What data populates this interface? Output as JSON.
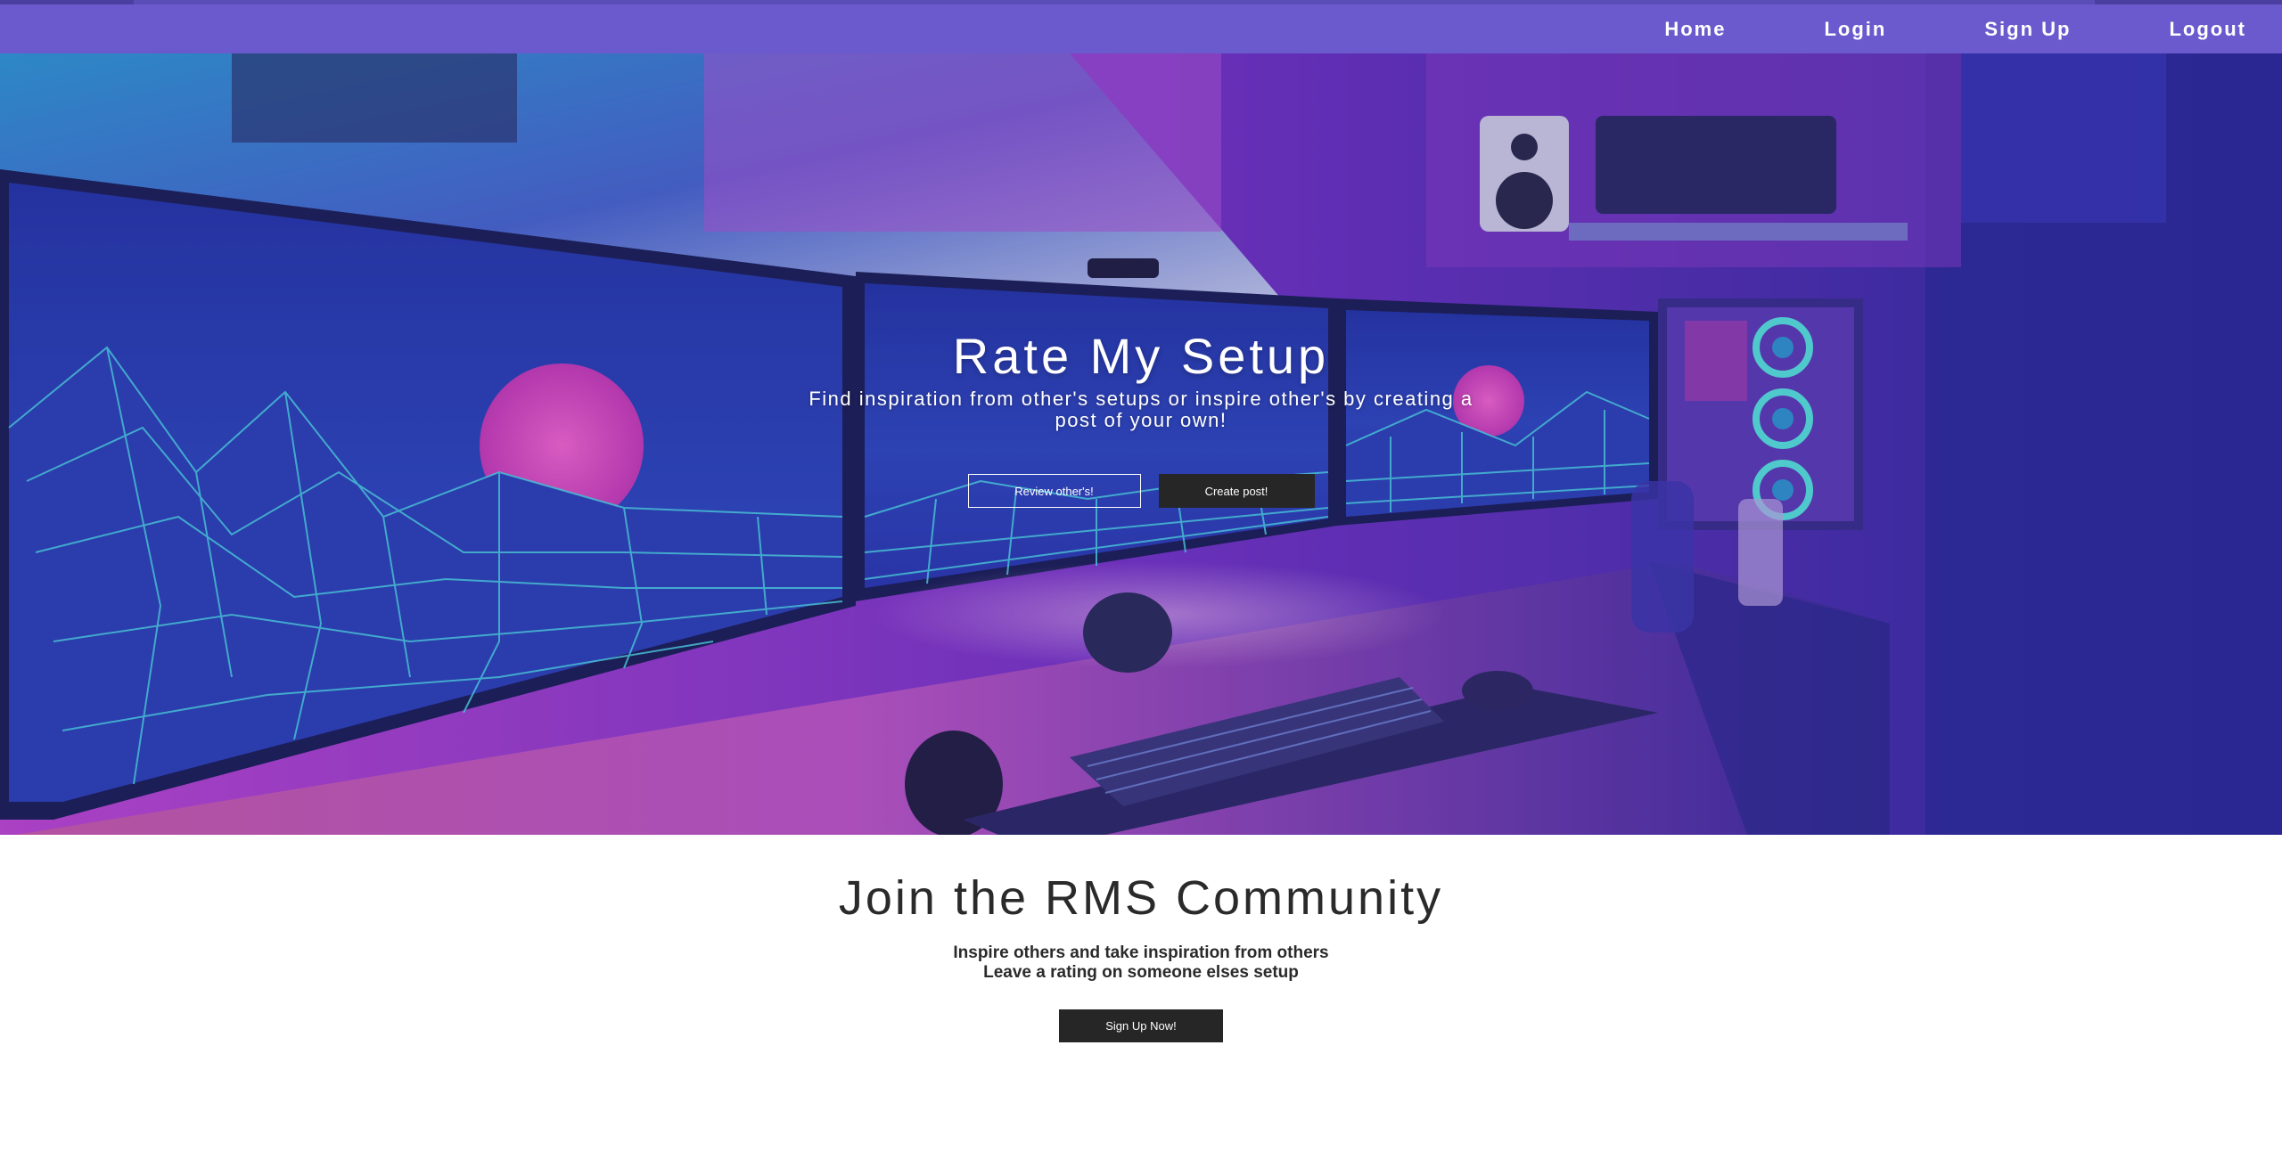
{
  "nav": {
    "items": [
      {
        "label": "Home"
      },
      {
        "label": "Login"
      },
      {
        "label": "Sign Up"
      },
      {
        "label": "Logout"
      }
    ]
  },
  "hero": {
    "title": "Rate My Setup",
    "subtitle": "Find inspiration from other's setups or inspire other's by creating a post of your own!",
    "review_button": "Review other's!",
    "create_button": "Create post!"
  },
  "community": {
    "title": "Join the RMS Community",
    "line1": "Inspire others and take inspiration from others",
    "line2": "Leave a rating on someone elses setup",
    "cta": "Sign Up Now!"
  },
  "colors": {
    "navbar": "#6a5acd",
    "button_dark": "#262626"
  }
}
